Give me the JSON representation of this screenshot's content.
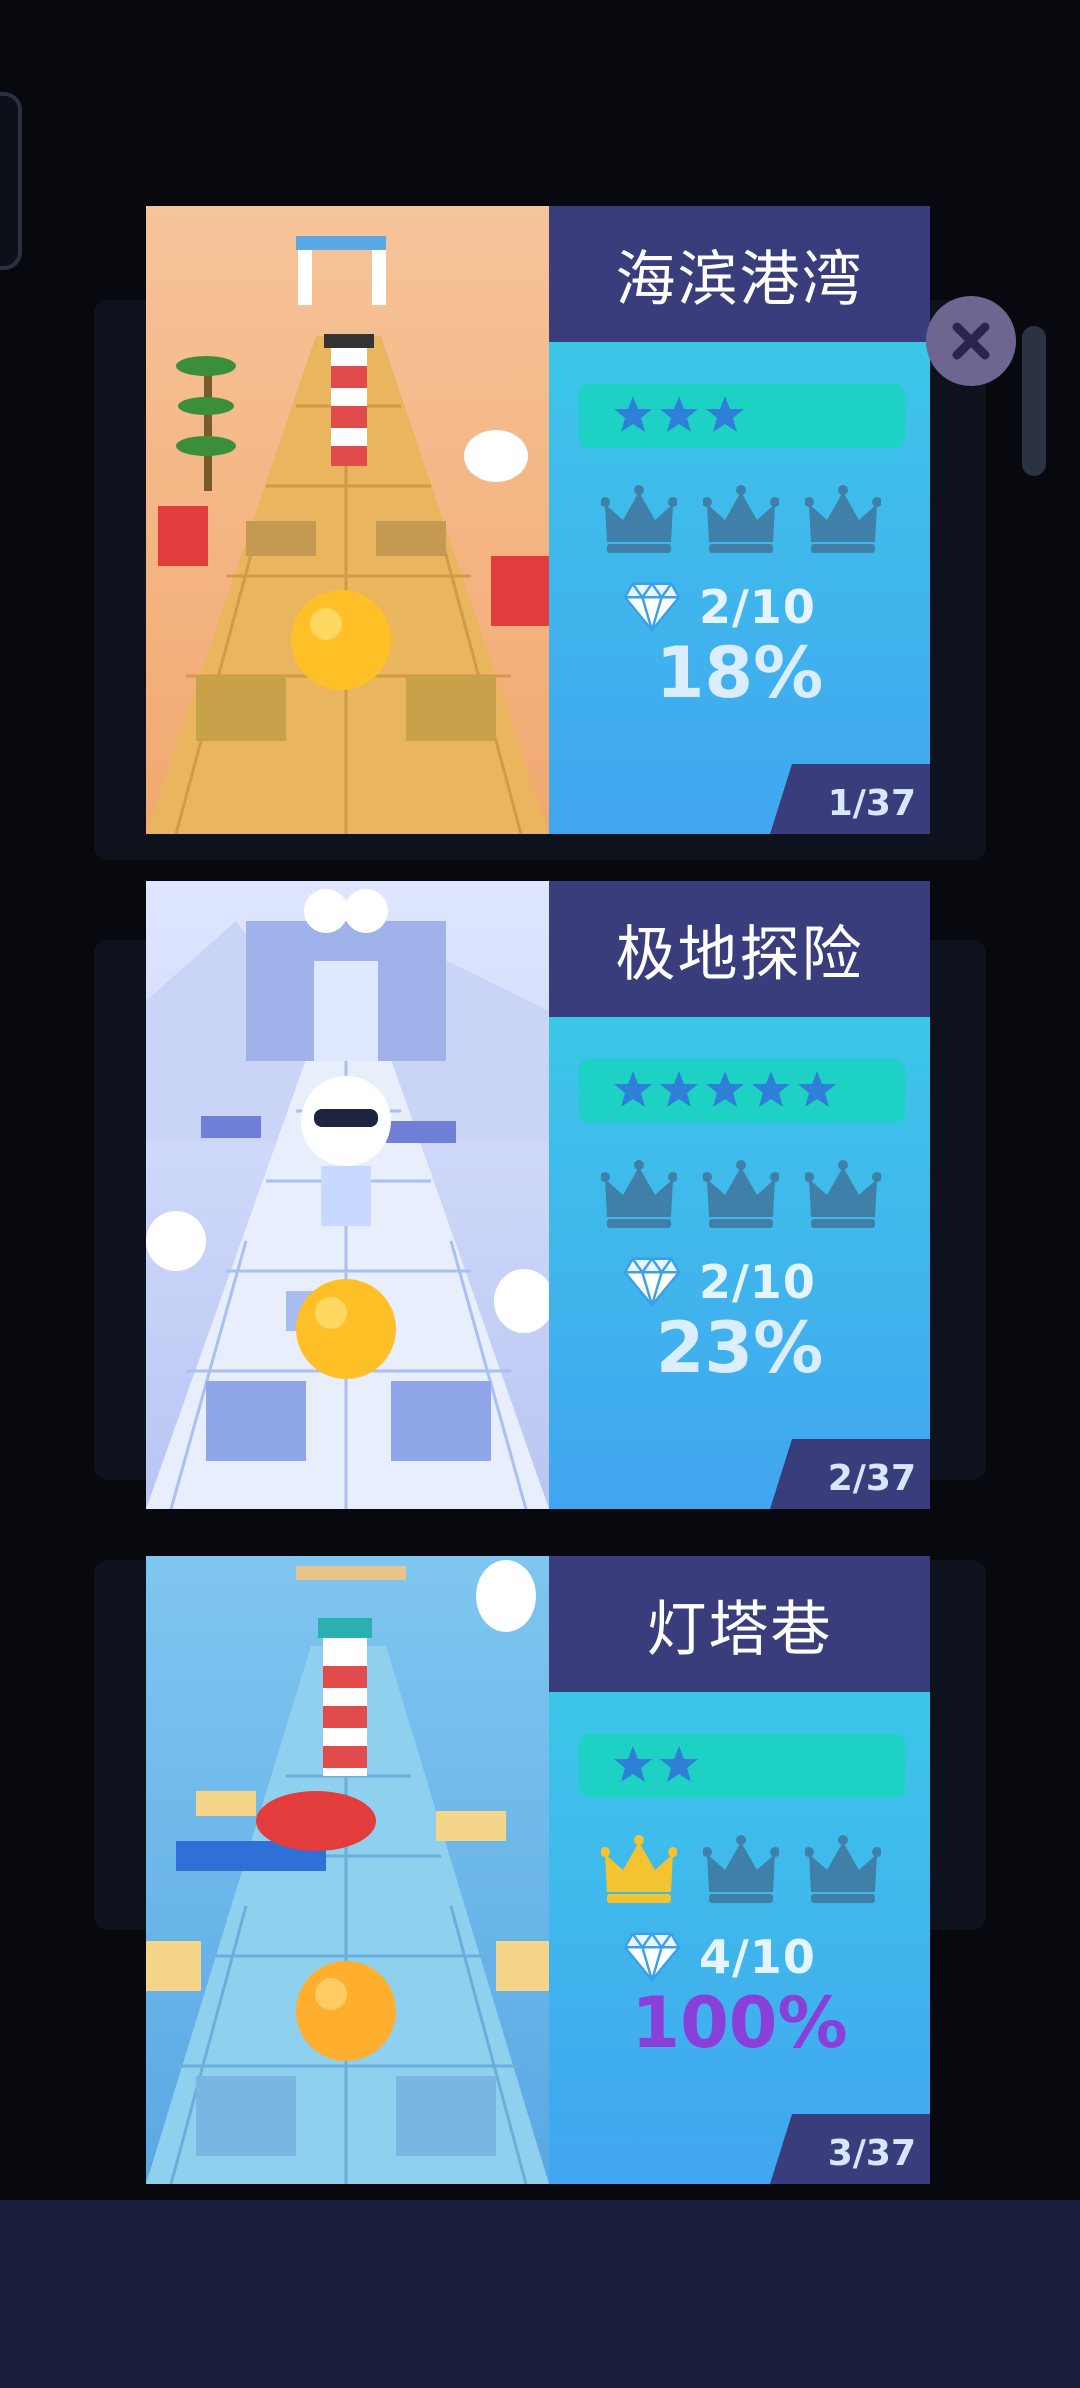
{
  "close_icon": "close-icon",
  "levels": [
    {
      "title": "海滨港湾",
      "stars": 3,
      "crowns_gold": 0,
      "gems": "2/10",
      "percent": "18%",
      "page": "1/37",
      "theme": "beach"
    },
    {
      "title": "极地探险",
      "stars": 5,
      "crowns_gold": 0,
      "gems": "2/10",
      "percent": "23%",
      "page": "2/37",
      "theme": "polar"
    },
    {
      "title": "灯塔巷",
      "stars": 2,
      "crowns_gold": 1,
      "gems": "4/10",
      "percent": "100%",
      "page": "3/37",
      "theme": "lighthouse"
    }
  ],
  "colors": {
    "title_bar": "#3a3d7c",
    "stars_bar": "#1dd1c5",
    "star": "#2f7fd9",
    "crown_inactive": "#3f7fa8",
    "crown_active": "#f4c430",
    "percent_complete": "#8a3fd8",
    "bottom_bar": "#1b1e3c"
  }
}
